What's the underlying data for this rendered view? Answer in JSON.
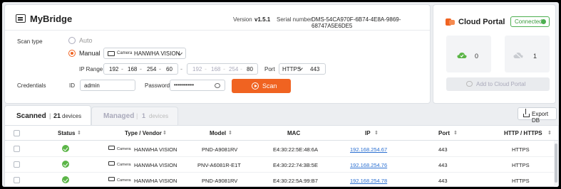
{
  "app": {
    "title": "MyBridge",
    "version_label": "Version",
    "version": "v1.5.1",
    "serial_label": "Serial number",
    "serial": "DMS-54CA970F-6B74-4E8A-9869-68747A5E6DE5"
  },
  "scan": {
    "type_label": "Scan type",
    "auto_label": "Auto",
    "manual_label": "Manual",
    "camera_tag": "Camera",
    "vendor": "HANWHA VISION",
    "ip_range_label": "IP Range",
    "ip_start": [
      "192",
      "168",
      "254",
      "60"
    ],
    "ip_end": [
      "192",
      "168",
      "254",
      "80"
    ],
    "port_label": "Port",
    "protocol": "HTTPS",
    "port": "443",
    "credentials_label": "Credentials",
    "id_label": "ID",
    "id_value": "admin",
    "password_label": "Password",
    "password_value": "••••••••••",
    "scan_button": "Scan"
  },
  "cloud": {
    "title": "Cloud Portal",
    "status": "Connected",
    "online_count": "0",
    "offline_count": "1",
    "add_button": "Add to Cloud Portal",
    "colors": {
      "online": "#5bb547",
      "offline": "#c8cbd0",
      "brand": "#f06321"
    }
  },
  "tabs": {
    "scanned": {
      "label": "Scanned",
      "count": "21",
      "unit": "devices"
    },
    "managed": {
      "label": "Managed",
      "count": "1",
      "unit": "devices"
    },
    "export_label": "Export DB"
  },
  "table": {
    "headers": [
      "Status",
      "Type / Vendor",
      "Model",
      "MAC",
      "IP",
      "Port",
      "HTTP / HTTPS"
    ],
    "rows": [
      {
        "type": "Camera",
        "vendor": "HANWHA VISION",
        "model": "PND-A9081RV",
        "mac": "E4:30:22:5E:48:6A",
        "ip": "192.168.254.67",
        "port": "443",
        "protocol": "HTTPS"
      },
      {
        "type": "Camera",
        "vendor": "HANWHA VISION",
        "model": "PNV-A6081R-E1T",
        "mac": "E4:30:22:74:3B:5E",
        "ip": "192.168.254.76",
        "port": "443",
        "protocol": "HTTPS"
      },
      {
        "type": "Camera",
        "vendor": "HANWHA VISION",
        "model": "PND-A9081RV",
        "mac": "E4:30:22:5A:99:B7",
        "ip": "192.168.254.78",
        "port": "443",
        "protocol": "HTTPS"
      }
    ]
  }
}
